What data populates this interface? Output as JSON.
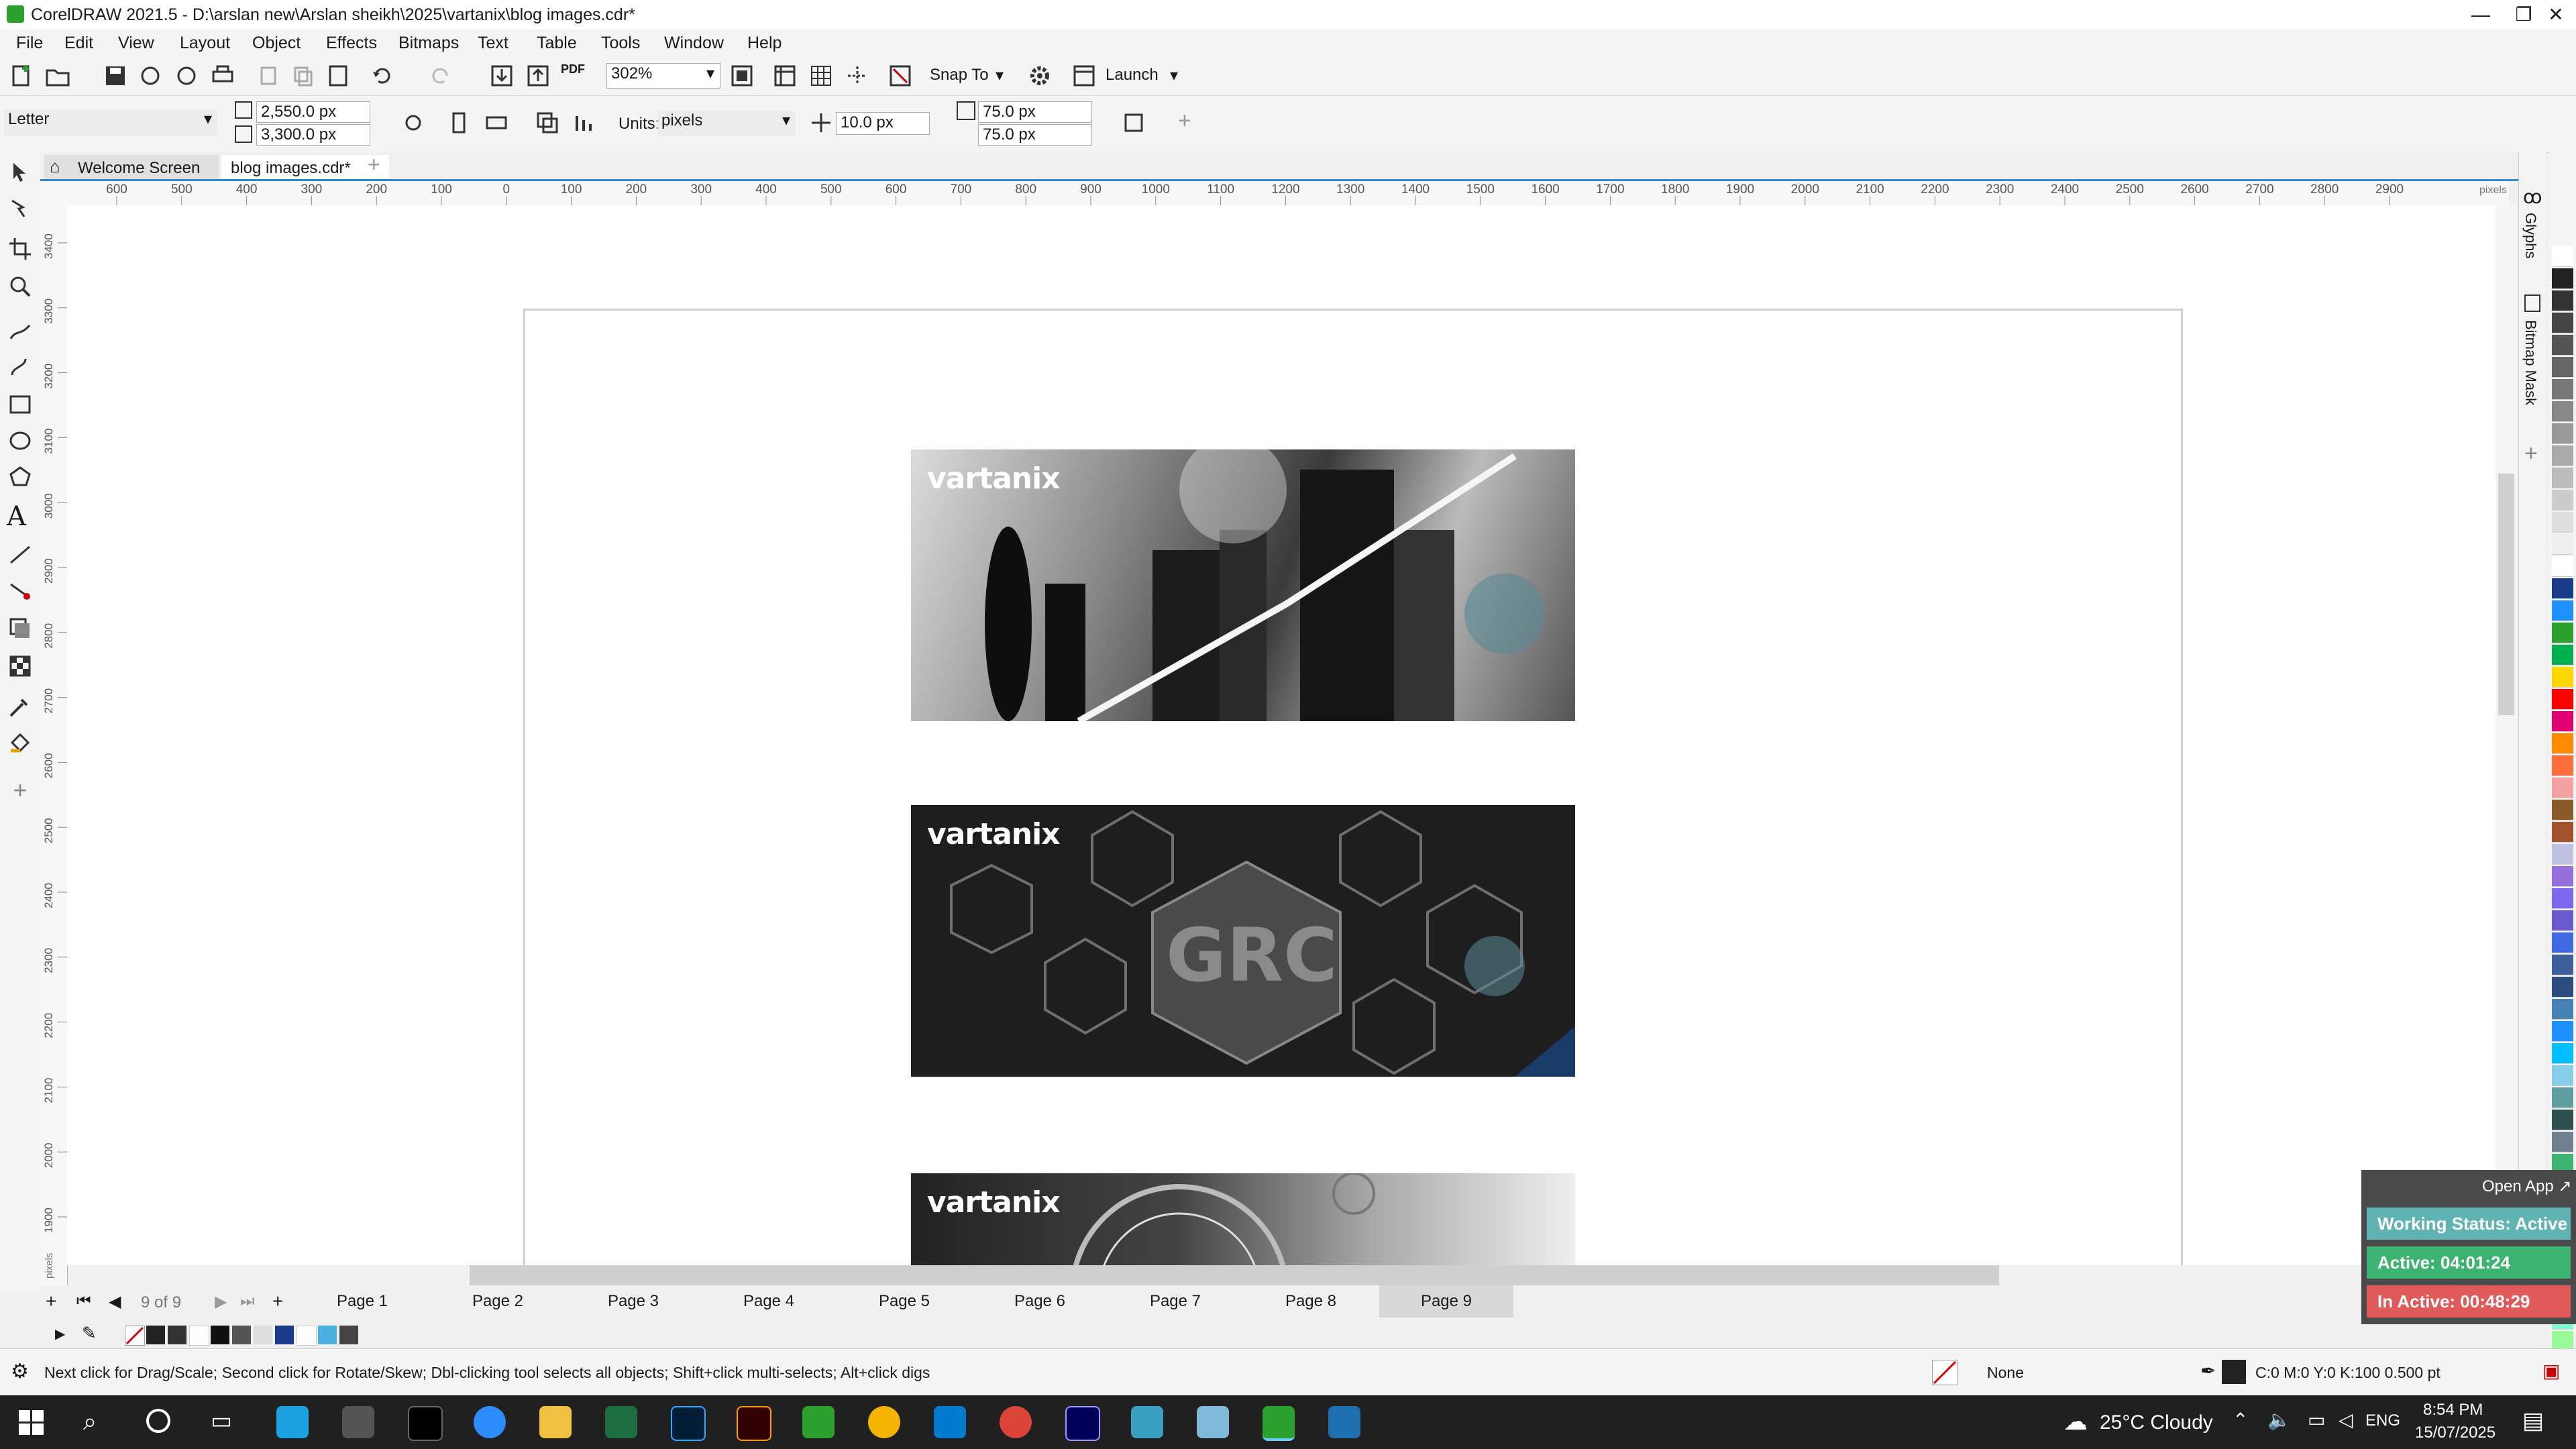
{
  "titlebar": {
    "title": "CorelDRAW 2021.5 - D:\\arslan new\\Arslan sheikh\\2025\\vartanix\\blog images.cdr*"
  },
  "menu": [
    "File",
    "Edit",
    "View",
    "Layout",
    "Object",
    "Effects",
    "Bitmaps",
    "Text",
    "Table",
    "Tools",
    "Window",
    "Help"
  ],
  "toolbar": {
    "zoom": "302%",
    "snap_to": "Snap To",
    "launch": "Launch"
  },
  "propbar": {
    "page_size": "Letter",
    "width": "2,550.0 px",
    "height": "3,300.0 px",
    "units_label": "Units:",
    "units": "pixels",
    "nudge": "10.0 px",
    "dup_x": "75.0 px",
    "dup_y": "75.0 px"
  },
  "doctabs": {
    "welcome": "Welcome Screen",
    "file": "blog images.cdr*"
  },
  "ruler": {
    "h_ticks": [
      "600",
      "500",
      "400",
      "300",
      "200",
      "100",
      "0",
      "100",
      "200",
      "300",
      "400",
      "500",
      "600",
      "700",
      "800",
      "900",
      "1000",
      "1100",
      "1200",
      "1300",
      "1400",
      "1500",
      "1600",
      "1700",
      "1800",
      "1900",
      "2000",
      "2100",
      "2200",
      "2300",
      "2400",
      "2500",
      "2600",
      "2700",
      "2800",
      "2900"
    ],
    "h_unit": "pixels",
    "v_ticks": [
      "3400",
      "3300",
      "3200",
      "3100",
      "3000",
      "2900",
      "2800",
      "2700",
      "2600",
      "2500",
      "2400",
      "2300",
      "2200",
      "2100",
      "2000",
      "1900"
    ],
    "v_unit": "pixels"
  },
  "images": {
    "logo": "vartanix",
    "grc": "GRC"
  },
  "dockers": {
    "glyphs": "Glyphs",
    "bitmap_mask": "Bitmap Mask"
  },
  "pages": {
    "counter": "9 of 9",
    "tabs": [
      "Page 1",
      "Page 2",
      "Page 3",
      "Page 4",
      "Page 5",
      "Page 6",
      "Page 7",
      "Page 8",
      "Page 9"
    ]
  },
  "status": {
    "hint": "Next click for Drag/Scale; Second click for Rotate/Skew; Dbl-clicking tool selects all objects; Shift+click multi-selects; Alt+click digs",
    "fill": "None",
    "outline": "C:0 M:0 Y:0 K:100  0.500 pt"
  },
  "widget": {
    "open_app": "Open App ↗",
    "working": "Working Status: Active",
    "active": "Active: 04:01:24",
    "inactive": "In Active: 00:48:29"
  },
  "taskbar": {
    "weather": "25°C  Cloudy",
    "lang": "ENG",
    "time": "8:54 PM",
    "date": "15/07/2025"
  },
  "colors": {
    "accent": "#2a8bd6",
    "active_green": "#3cb371",
    "inactive_red": "#e05a5a",
    "status_teal": "#5fb3b3"
  }
}
